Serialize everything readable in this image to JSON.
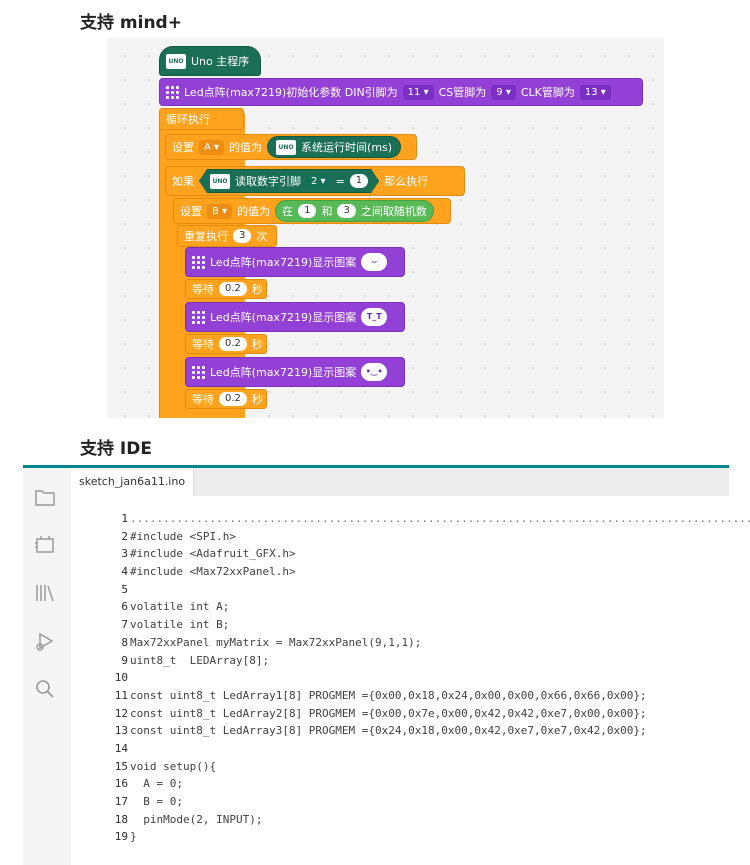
{
  "headings": {
    "mind": "支持 mind+",
    "ide": "支持 IDE"
  },
  "blocks": {
    "hat": {
      "uno_icon": "UNO",
      "label": "Uno 主程序"
    },
    "init": {
      "label": "Led点阵(max7219)初始化参数 DIN引脚为",
      "din": "11",
      "cs_label": "CS管脚为",
      "cs": "9",
      "clk_label": "CLK管脚为",
      "clk": "13"
    },
    "loop": {
      "label": "循环执行"
    },
    "set_a": {
      "label": "设置",
      "var": "A",
      "value_label": "的值为",
      "reporter": "系统运行时间(ms)"
    },
    "if": {
      "label": "如果",
      "read_label": "读取数字引脚",
      "pin": "2",
      "eq": "=",
      "value": "1",
      "then": "那么执行"
    },
    "set_b": {
      "label": "设置",
      "var": "B",
      "value_label": "的值为",
      "between": "在",
      "min": "1",
      "and": "和",
      "max": "3",
      "rand": "之间取随机数"
    },
    "repeat": {
      "label": "重复执行",
      "count": "3",
      "unit": "次"
    },
    "show1": {
      "label": "Led点阵(max7219)显示图案",
      "face": "⌣"
    },
    "wait1": {
      "label": "等待",
      "secs": "0.2",
      "unit": "秒"
    },
    "show2": {
      "label": "Led点阵(max7219)显示图案",
      "face": "T_T"
    },
    "wait2": {
      "label": "等待",
      "secs": "0.2",
      "unit": "秒"
    },
    "show3": {
      "label": "Led点阵(max7219)显示图案",
      "face": "•‿•"
    },
    "wait3": {
      "label": "等待",
      "secs": "0.2",
      "unit": "秒"
    }
  },
  "ide": {
    "tab": "sketch_jan6a11.ino",
    "sidebar_icons": [
      "folder-icon",
      "board-icon",
      "library-icon",
      "debug-icon",
      "search-icon"
    ],
    "lines": [
      "",
      "#include <SPI.h>",
      "#include <Adafruit_GFX.h>",
      "#include <Max72xxPanel.h>",
      "",
      "volatile int A;",
      "volatile int B;",
      "Max72xxPanel myMatrix = Max72xxPanel(9,1,1);",
      "uint8_t  LEDArray[8];",
      "",
      "const uint8_t LedArray1[8] PROGMEM ={0x00,0x18,0x24,0x00,0x00,0x66,0x66,0x00};",
      "const uint8_t LedArray2[8] PROGMEM ={0x00,0x7e,0x00,0x42,0x42,0xe7,0x00,0x00};",
      "const uint8_t LedArray3[8] PROGMEM ={0x24,0x18,0x00,0x42,0xe7,0xe7,0x42,0x00};",
      "",
      "void setup(){",
      "  A = 0;",
      "  B = 0;",
      "  pinMode(2, INPUT);",
      "}"
    ],
    "line_numbers": [
      "1",
      "2",
      "3",
      "4",
      "5",
      "6",
      "7",
      "8",
      "9",
      "10",
      "11",
      "12",
      "13",
      "14",
      "15",
      "16",
      "17",
      "18",
      "19"
    ]
  }
}
